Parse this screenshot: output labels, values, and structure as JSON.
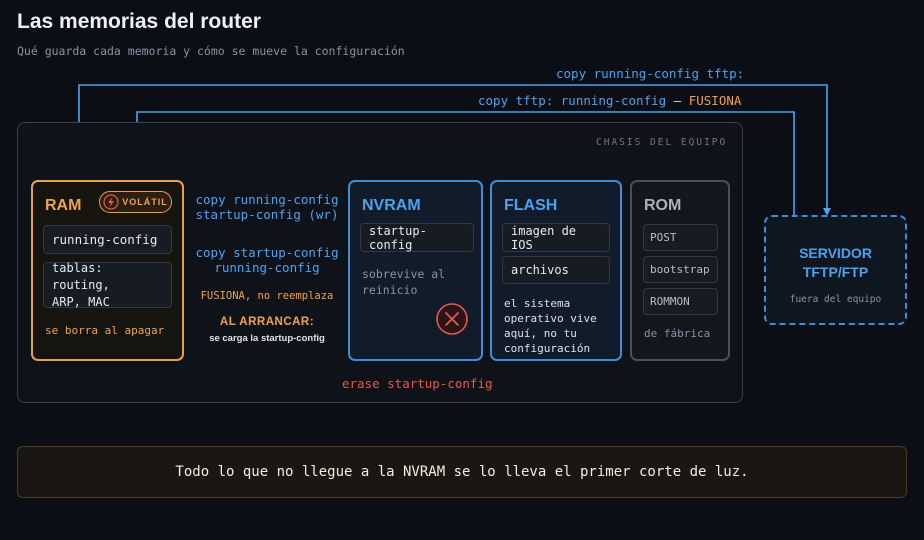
{
  "header": {
    "title": "Las memorias del router",
    "subtitle": "Qué guarda cada memoria y cómo se mueve la configuración"
  },
  "top_commands": {
    "copy_to_tftp": "copy running-config tftp:",
    "copy_from_tftp": "copy tftp: running-config",
    "copy_from_tftp_dash": " — ",
    "copy_from_tftp_note": "FUSIONA"
  },
  "chassis": {
    "label": "CHASIS DEL EQUIPO"
  },
  "ram": {
    "title": "RAM",
    "badge": "VOLÁTIL",
    "badge_icon": "lightning-icon",
    "chip_1": "running-config",
    "chip_2_line1": "tablas: routing,",
    "chip_2_line2": "ARP, MAC",
    "note": "se borra al apagar"
  },
  "arrows": {
    "save_line1": "copy running-config",
    "save_line2": "startup-config (wr)",
    "restore_line1": "copy startup-config",
    "restore_line2": "running-config",
    "restore_note": "FUSIONA, no reemplaza",
    "boot_label": "AL ARRANCAR:",
    "boot_note": "se carga la startup-config"
  },
  "nvram": {
    "title": "NVRAM",
    "chip_1": "startup-config",
    "note_line1": "sobrevive al",
    "note_line2": "reinicio",
    "erase_icon": "erase-x-icon",
    "erase_label": "erase startup-config"
  },
  "flash": {
    "title": "FLASH",
    "chip_1": "imagen de IOS",
    "chip_2": "archivos",
    "note_line1": "el sistema",
    "note_line2": "operativo vive",
    "note_line3": "aquí, no tu",
    "note_line4": "configuración"
  },
  "rom": {
    "title": "ROM",
    "chip_1": "POST",
    "chip_2": "bootstrap",
    "chip_3": "ROMMON",
    "note": "de fábrica"
  },
  "server": {
    "title_line1": "SERVIDOR",
    "title_line2": "TFTP/FTP",
    "note": "fuera del equipo"
  },
  "footer": {
    "text": "Todo lo que no llegue a la NVRAM se lo lleva el primer corte de luz."
  },
  "colors": {
    "accent_blue": "#4aa3f0",
    "accent_orange": "#f0a34a",
    "accent_red": "#e05a4d",
    "background": "#0b0e15"
  }
}
